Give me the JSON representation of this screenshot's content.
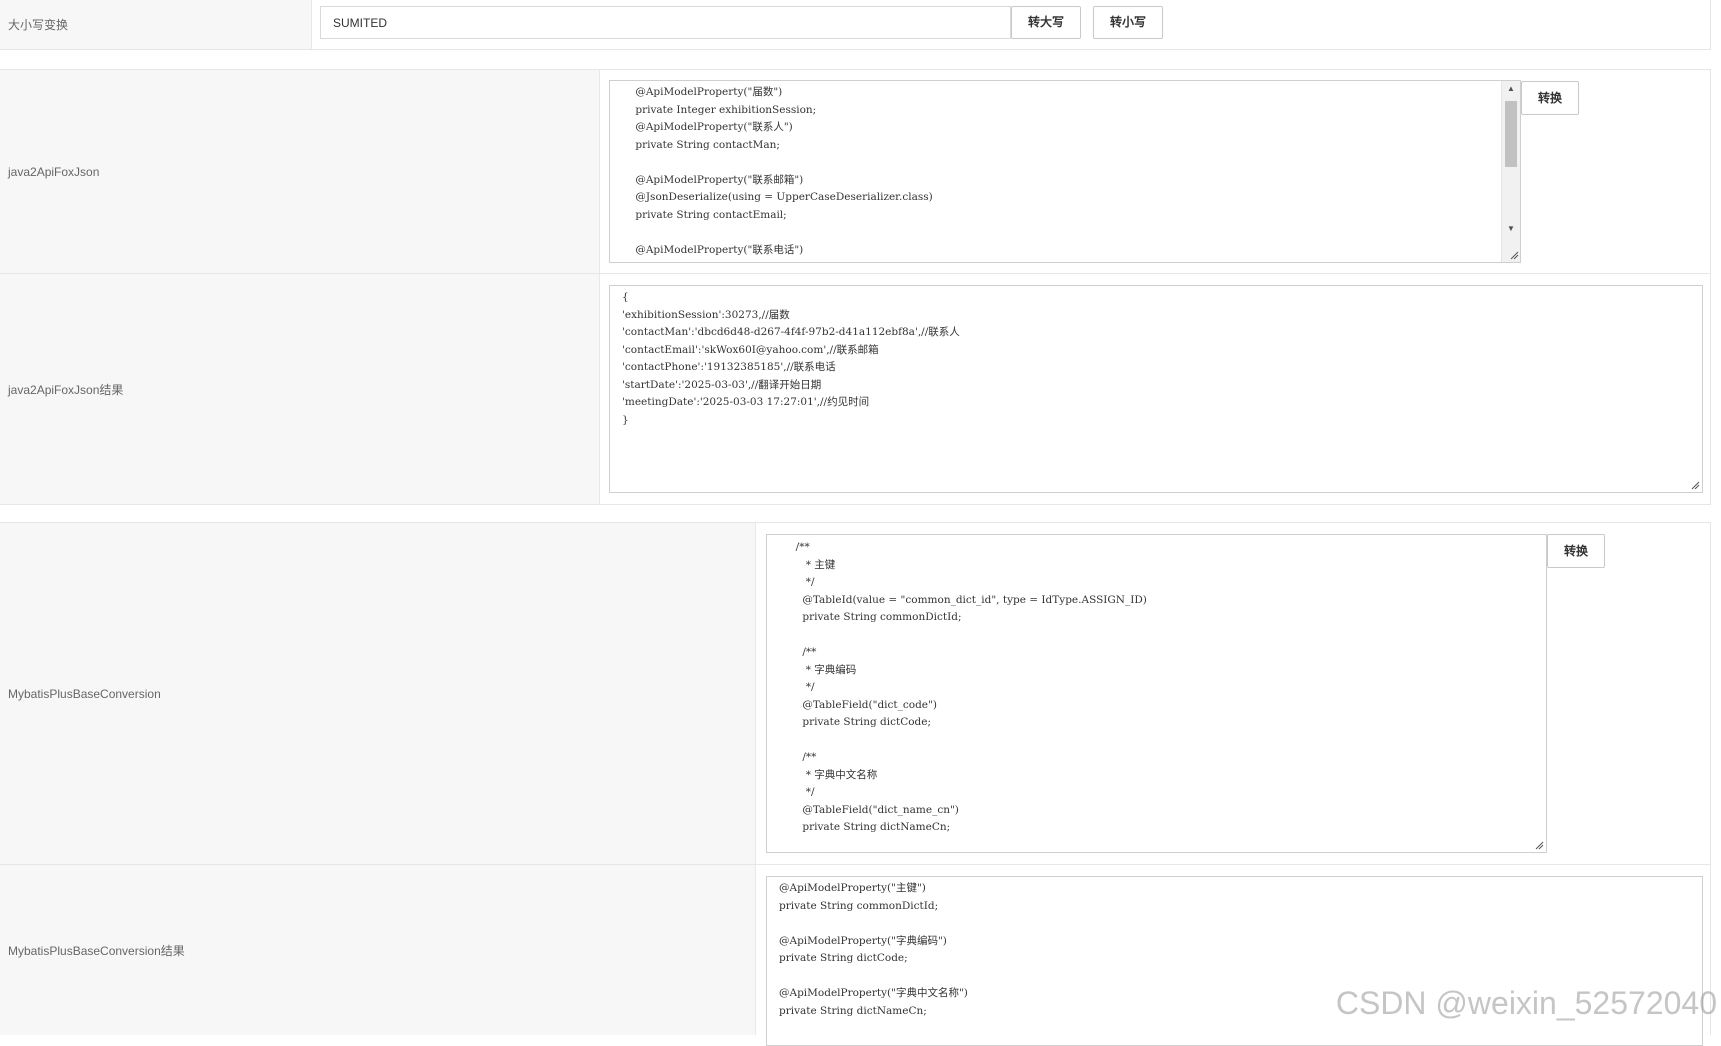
{
  "case_convert": {
    "label": "大小写变换",
    "input_value": "SUMITED",
    "upper_button": "转大写",
    "lower_button": "转小写"
  },
  "java2apifox": {
    "label": "java2ApiFoxJson",
    "button": "转换",
    "code": "    @ApiModelProperty(\"届数\")\n    private Integer exhibitionSession;\n    @ApiModelProperty(\"联系人\")\n    private String contactMan;\n\n    @ApiModelProperty(\"联系邮箱\")\n    @JsonDeserialize(using = UpperCaseDeserializer.class)\n    private String contactEmail;\n\n    @ApiModelProperty(\"联系电话\")"
  },
  "java2apifox_result": {
    "label": "java2ApiFoxJson结果",
    "code": "{\n'exhibitionSession':30273,//届数\n'contactMan':'dbcd6d48-d267-4f4f-97b2-d41a112ebf8a',//联系人\n'contactEmail':'skWox60I@yahoo.com',//联系邮箱\n'contactPhone':'19132385185',//联系电话\n'startDate':'2025-03-03',//翻译开始日期\n'meetingDate':'2025-03-03 17:27:01',//约见时间\n}"
  },
  "mybatis": {
    "label": "MybatisPlusBaseConversion",
    "button": "转换",
    "code": "  /**\n     * 主键\n     */\n    @TableId(value = \"common_dict_id\", type = IdType.ASSIGN_ID)\n    private String commonDictId;\n\n    /**\n     * 字典编码\n     */\n    @TableField(\"dict_code\")\n    private String dictCode;\n\n    /**\n     * 字典中文名称\n     */\n    @TableField(\"dict_name_cn\")\n    private String dictNameCn;"
  },
  "mybatis_result": {
    "label": "MybatisPlusBaseConversion结果",
    "code": "@ApiModelProperty(\"主键\")\nprivate String commonDictId;\n\n@ApiModelProperty(\"字典编码\")\nprivate String dictCode;\n\n@ApiModelProperty(\"字典中文名称\")\nprivate String dictNameCn;"
  },
  "watermark": "CSDN @weixin_52572040"
}
